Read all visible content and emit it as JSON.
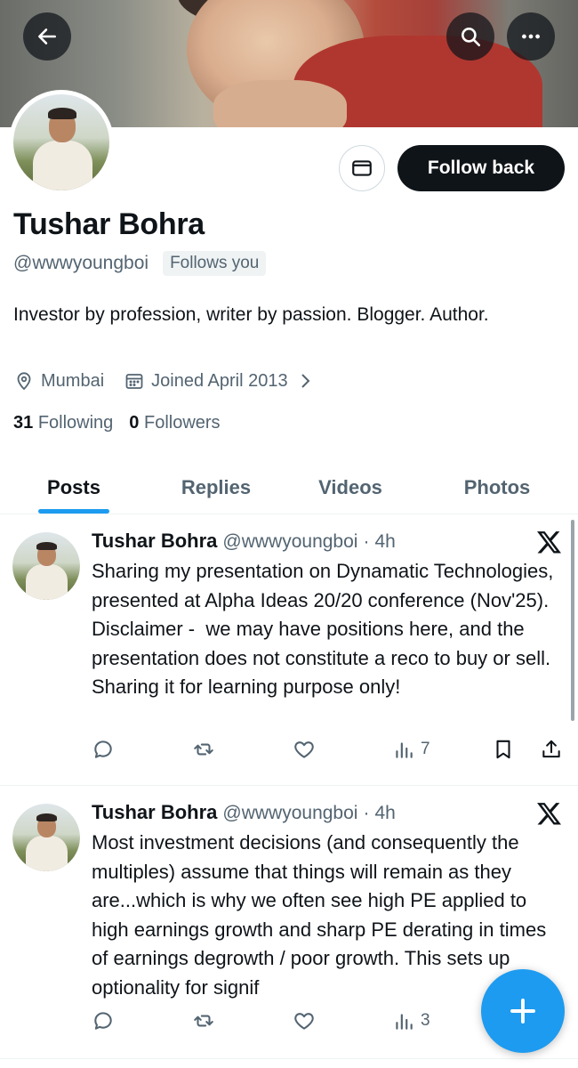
{
  "profile": {
    "name": "Tushar Bohra",
    "handle": "@wwwyoungboi",
    "follows_you": "Follows you",
    "bio": "Investor by profession, writer by passion. Blogger. Author.",
    "location": "Mumbai",
    "joined": "Joined April 2013",
    "following_count": "31",
    "following_label": "Following",
    "followers_count": "0",
    "followers_label": "Followers"
  },
  "header": {
    "back_icon": "arrow-left-icon",
    "search_icon": "search-icon",
    "more_icon": "more-dots-icon"
  },
  "actions": {
    "message_icon": "envelope-icon",
    "follow_label": "Follow back"
  },
  "tabs": [
    {
      "label": "Posts",
      "active": true
    },
    {
      "label": "Replies",
      "active": false
    },
    {
      "label": "Videos",
      "active": false
    },
    {
      "label": "Photos",
      "active": false
    }
  ],
  "posts": [
    {
      "name": "Tushar Bohra",
      "handle": "@wwwyoungboi",
      "dot": "·",
      "time": "4h",
      "text": "Sharing my presentation on Dynamatic Technologies, presented at Alpha Ideas 20/20 conference (Nov'25).     Disclaimer -  we may have positions here, and the presentation does not constitute a reco to buy or sell. Sharing it for learning purpose only!",
      "views": "7"
    },
    {
      "name": "Tushar Bohra",
      "handle": "@wwwyoungboi",
      "dot": "·",
      "time": "4h",
      "text": "Most investment decisions (and consequently the multiples) assume that things will remain as they are...which is why we often see high PE applied to high earnings growth and sharp PE derating in times of earnings degrowth / poor growth. This sets up optionality for signif",
      "views": "3"
    }
  ],
  "colors": {
    "accent": "#1d9bf0",
    "text_primary": "#0f1419",
    "text_secondary": "#536471"
  }
}
